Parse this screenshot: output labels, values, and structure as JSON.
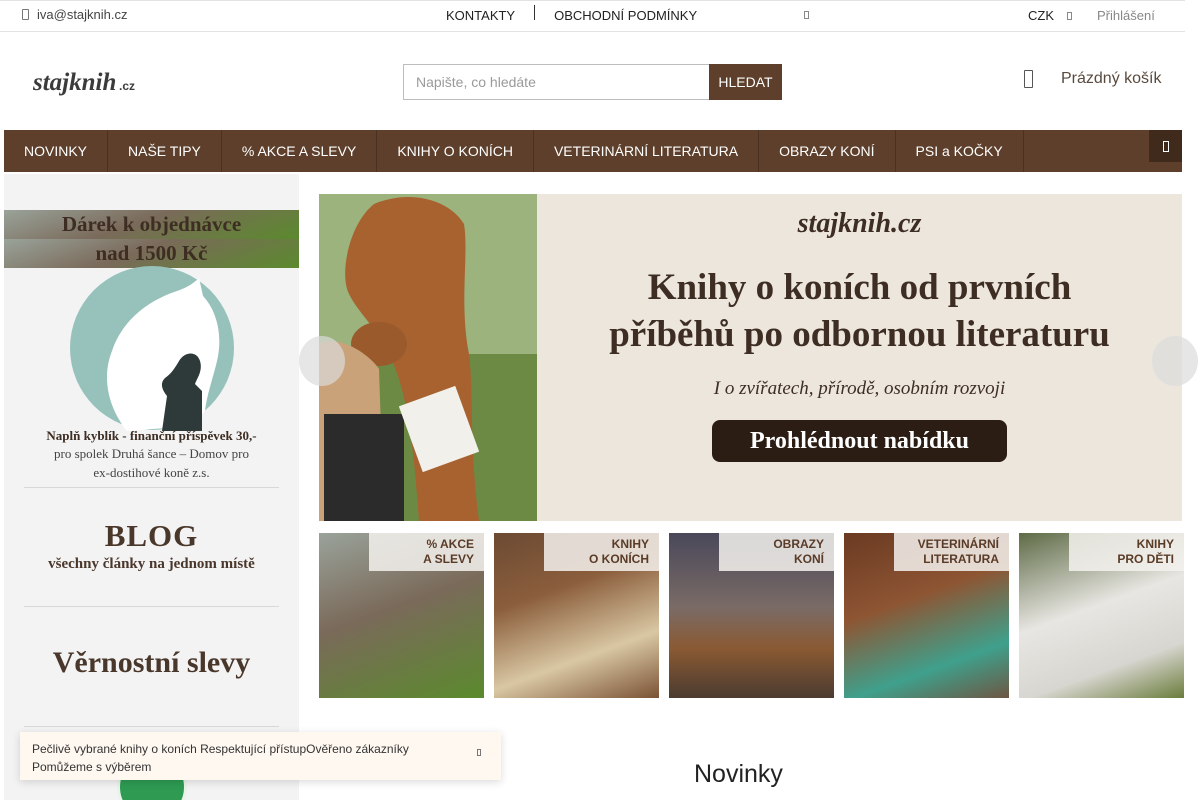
{
  "topbar": {
    "email": "iva@stajknih.cz",
    "links": [
      "KONTAKTY",
      "OBCHODNÍ PODMÍNKY"
    ],
    "currency": "CZK",
    "login": "Přihlášení"
  },
  "header": {
    "logo_text": "stajknih.cz",
    "search_placeholder": "Napište, co hledáte",
    "search_button": "HLEDAT",
    "cart_label": "Prázdný košík"
  },
  "nav": {
    "items": [
      "NOVINKY",
      "NAŠE TIPY",
      "% AKCE A SLEVY",
      "KNIHY O KONÍCH",
      "VETERINÁRNÍ LITERATURA",
      "OBRAZY KONÍ",
      "PSI a KOČKY"
    ]
  },
  "sidebar": {
    "gift_title_1": "Dárek k objednávce",
    "gift_title_2": "nad 1500 Kč",
    "gift_bold": "Naplň kyblík - finanční příspěvek 30,-",
    "gift_line_1": "pro spolek Druhá šance – Domov pro",
    "gift_line_2": "ex-dostihové koně z.s.",
    "blog_big": "BLOG",
    "blog_small": "všechny články na jednom místě",
    "loyalty": "Věrnostní slevy"
  },
  "hero": {
    "brand": "stajknih.cz",
    "headline_1": "Knihy o koních od prvních",
    "headline_2": "příběhů po odbornou literaturu",
    "subline": "I o zvířatech, přírodě, osobním rozvoji",
    "cta": "Prohlédnout nabídku"
  },
  "tiles": [
    {
      "l1": "% AKCE",
      "l2": "A SLEVY"
    },
    {
      "l1": "KNIHY",
      "l2": "O KONÍCH"
    },
    {
      "l1": "OBRAZY",
      "l2": "KONÍ"
    },
    {
      "l1": "VETERINÁRNÍ",
      "l2": "LITERATURA"
    },
    {
      "l1": "KNIHY",
      "l2": "PRO DĚTI"
    }
  ],
  "info": {
    "line_1": " Pečlivě vybrané knihy o koních  Respektující přístupOvěřeno zákazníky ",
    "line_2": "Pomůžeme s výběrem"
  },
  "section": {
    "title": "Novinky"
  },
  "colors": {
    "brand_brown": "#5d3f2b",
    "dark_brown": "#2c1d14",
    "sidebar_bg": "#f3f3f3"
  }
}
